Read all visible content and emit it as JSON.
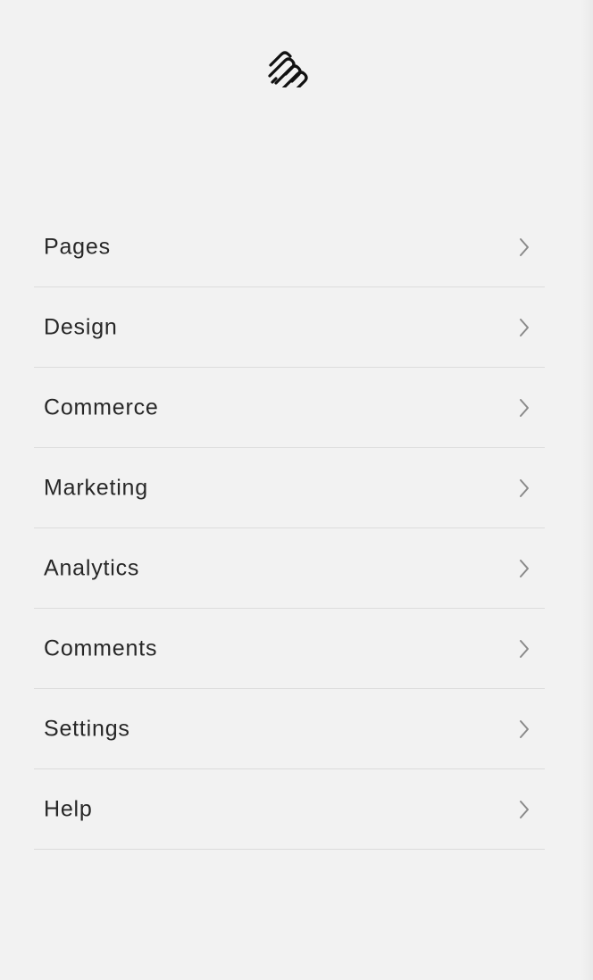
{
  "brand": {
    "logo_icon": "squarespace-logo-icon",
    "colors": {
      "background": "#f2f2f2",
      "text": "#272727",
      "divider": "#dcdcdc",
      "chevron": "#8a8a8a"
    }
  },
  "menu": {
    "items": [
      {
        "label": "Pages",
        "icon": "chevron-right-icon"
      },
      {
        "label": "Design",
        "icon": "chevron-right-icon"
      },
      {
        "label": "Commerce",
        "icon": "chevron-right-icon"
      },
      {
        "label": "Marketing",
        "icon": "chevron-right-icon"
      },
      {
        "label": "Analytics",
        "icon": "chevron-right-icon"
      },
      {
        "label": "Comments",
        "icon": "chevron-right-icon"
      },
      {
        "label": "Settings",
        "icon": "chevron-right-icon"
      },
      {
        "label": "Help",
        "icon": "chevron-right-icon"
      }
    ]
  }
}
